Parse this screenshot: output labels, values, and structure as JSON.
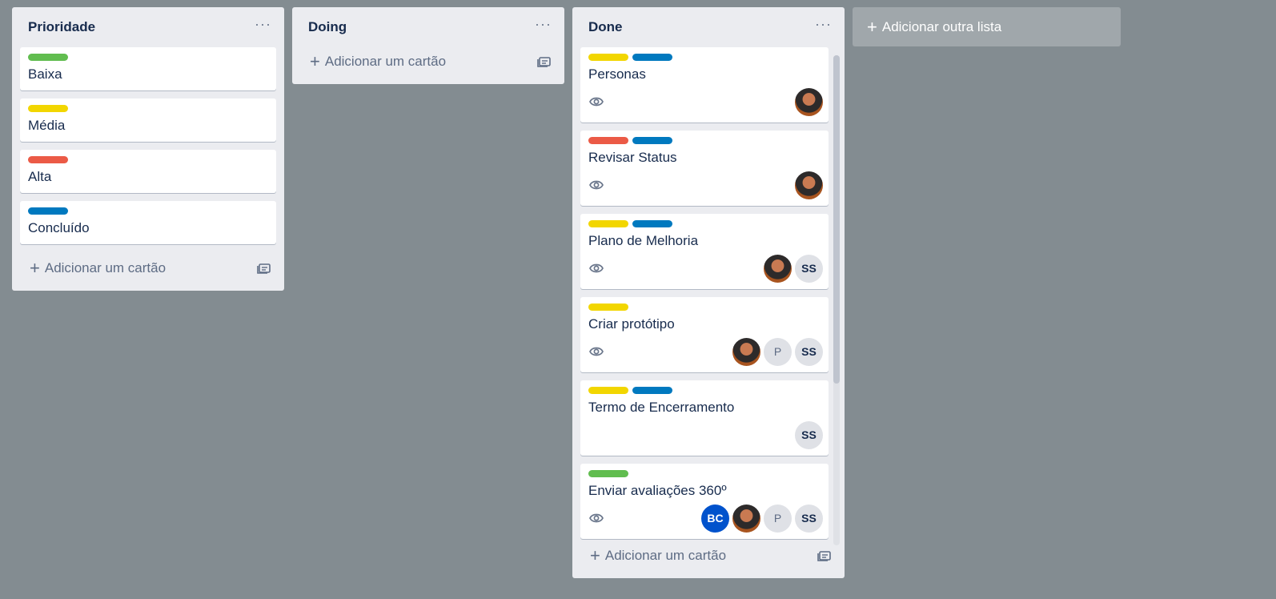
{
  "lists": [
    {
      "title": "Prioridade",
      "cards": [
        {
          "title": "Baixa",
          "labels": [
            "#61bd4f"
          ]
        },
        {
          "title": "Média",
          "labels": [
            "#f2d600"
          ]
        },
        {
          "title": "Alta",
          "labels": [
            "#eb5a46"
          ]
        },
        {
          "title": "Concluído",
          "labels": [
            "#0079bf"
          ]
        }
      ],
      "add_card": "Adicionar um cartão"
    },
    {
      "title": "Doing",
      "cards": [],
      "add_card": "Adicionar um cartão"
    },
    {
      "title": "Done",
      "cards": [
        {
          "title": "Personas",
          "labels": [
            "#f2d600",
            "#0079bf"
          ],
          "watch": true,
          "members": [
            "photo"
          ]
        },
        {
          "title": "Revisar Status",
          "labels": [
            "#eb5a46",
            "#0079bf"
          ],
          "watch": true,
          "members": [
            "photo"
          ]
        },
        {
          "title": "Plano de Melhoria",
          "labels": [
            "#f2d600",
            "#0079bf"
          ],
          "watch": true,
          "members": [
            "photo",
            "SS"
          ]
        },
        {
          "title": "Criar protótipo",
          "labels": [
            "#f2d600"
          ],
          "watch": true,
          "members": [
            "photo",
            "P",
            "SS"
          ]
        },
        {
          "title": "Termo de Encerramento",
          "labels": [
            "#f2d600",
            "#0079bf"
          ],
          "watch": false,
          "members": [
            "SS"
          ]
        },
        {
          "title": "Enviar avaliações 360º",
          "labels": [
            "#61bd4f"
          ],
          "watch": true,
          "members": [
            "BC",
            "photo",
            "P",
            "SS"
          ]
        }
      ],
      "add_card": "Adicionar um cartão"
    }
  ],
  "add_list": "Adicionar outra lista",
  "icons": {
    "menu": "ellipsis-icon",
    "add": "plus-icon",
    "template": "card-template-icon",
    "watch": "eye-icon"
  }
}
